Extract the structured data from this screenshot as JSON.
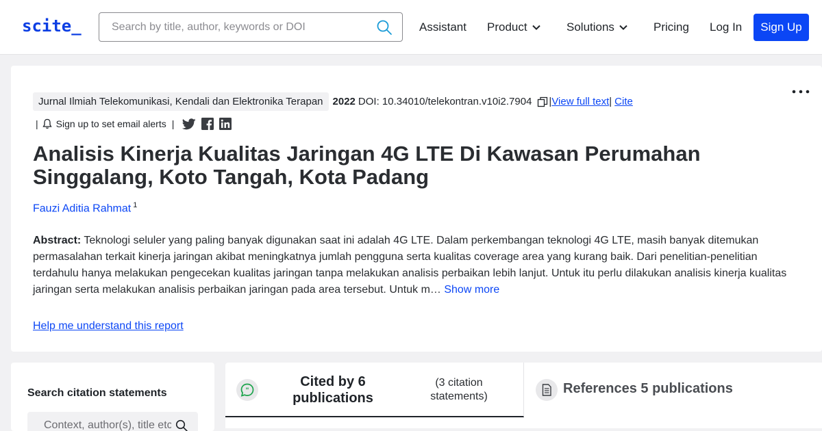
{
  "header": {
    "logo": "scite_",
    "search_placeholder": "Search by title, author, keywords or DOI",
    "nav": {
      "assistant": "Assistant",
      "product": "Product",
      "solutions": "Solutions",
      "pricing": "Pricing",
      "login": "Log In",
      "signup": "Sign Up"
    }
  },
  "paper": {
    "journal": "Jurnal Ilmiah Telekomunikasi, Kendali dan Elektronika Terapan",
    "year": "2022",
    "doi": "DOI: 10.34010/telekontran.v10i2.7904",
    "separator": "|",
    "view_full_text": "View full text",
    "cite": "Cite",
    "email_alerts": "Sign up to set email alerts",
    "title": "Analisis Kinerja Kualitas Jaringan 4G LTE Di Kawasan Perumahan Singgalang, Koto Tangah, Kota Padang",
    "author": "Fauzi Aditia Rahmat",
    "author_affiliation": "1",
    "abstract_label": "Abstract:",
    "abstract_text": "Teknologi seluler yang paling banyak digunakan saat ini adalah 4G LTE. Dalam perkembangan teknologi 4G LTE, masih banyak ditemukan permasalahan terkait kinerja jaringan akibat meningkatnya jumlah pengguna serta kualitas coverage area yang kurang baik. Dari penelitian-penelitian terdahulu hanya melakukan pengecekan kualitas jaringan tanpa melakukan analisis perbaikan lebih lanjut. Untuk itu perlu dilakukan analisis kinerja kualitas jaringan serta melakukan analisis perbaikan jaringan pada area tersebut. Untuk m…",
    "show_more": "Show more",
    "help_link": "Help me understand this report"
  },
  "side_panel": {
    "title": "Search citation statements",
    "search_placeholder": "Context, author(s), title etc."
  },
  "tabs": {
    "cited_by": "Cited by 6 publications",
    "cited_statements": "(3 citation statements)",
    "references": "References 5 publications"
  },
  "colors": {
    "brand_blue": "#0b46f5",
    "accent_green": "#1aa34a",
    "page_bg": "#f1f1f3"
  }
}
